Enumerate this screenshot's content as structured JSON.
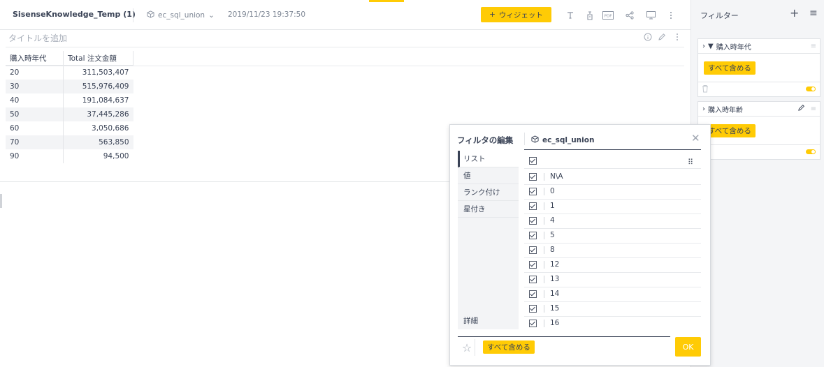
{
  "topbar": {
    "dashboard_title": "SisenseKnowledge_Temp (1)",
    "datasource": "ec_sql_union",
    "datasource_chevron": "⌄",
    "timestamp": "2019/11/23 19:37:50",
    "widget_button_plus": "+",
    "widget_button_label": "ウィジェット",
    "icons": [
      "text-icon",
      "filter-funnel-icon",
      "pdf-icon",
      "share-icon",
      "monitor-icon",
      "more-vertical-icon"
    ]
  },
  "widget": {
    "title_placeholder": "タイトルを追加",
    "columns": [
      "購入時年代",
      "Total 注文金額"
    ],
    "rows": [
      {
        "age": "20",
        "total": "311,503,407"
      },
      {
        "age": "30",
        "total": "515,976,409"
      },
      {
        "age": "40",
        "total": "191,084,637"
      },
      {
        "age": "50",
        "total": "37,445,286"
      },
      {
        "age": "60",
        "total": "3,050,686"
      },
      {
        "age": "70",
        "total": "563,850"
      },
      {
        "age": "90",
        "total": "94,500"
      }
    ]
  },
  "filter_panel": {
    "title": "フィルター",
    "plus": "+",
    "menu": "≡",
    "cards": [
      {
        "caret": "›",
        "funnel": "▼",
        "label": "購入時年代",
        "include_label": "すべて含める"
      },
      {
        "caret": "›",
        "label": "購入時年齢",
        "include_label": "すべて含める"
      }
    ]
  },
  "filter_editor": {
    "title": "フィルタの編集",
    "datasource": "ec_sql_union",
    "close": "✕",
    "tabs": [
      "リスト",
      "値",
      "ランク付け",
      "星付き"
    ],
    "details_tab": "詳細",
    "items": [
      "N\\A",
      "0",
      "1",
      "4",
      "5",
      "8",
      "12",
      "13",
      "14",
      "15",
      "16"
    ],
    "include_all_label": "すべて含める",
    "ok_label": "OK",
    "star": "☆",
    "grid_icon": "⠿"
  },
  "colors": {
    "accent": "#ffcb05",
    "text": "#3a4356",
    "muted": "#a4abb6",
    "panel_bg": "#f4f5f7"
  }
}
